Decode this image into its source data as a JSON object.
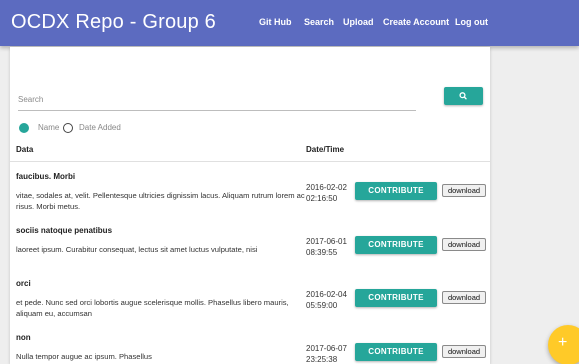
{
  "app": {
    "title": "OCDX Repo - Group 6"
  },
  "nav": {
    "items": [
      {
        "label": "Git Hub"
      },
      {
        "label": "Search"
      },
      {
        "label": "Upload"
      },
      {
        "label": "Create Account"
      },
      {
        "label": "Log out"
      }
    ]
  },
  "search": {
    "placeholder": "Search",
    "value": "",
    "button_icon": "search-icon"
  },
  "sort": {
    "options": [
      {
        "label": "Name",
        "selected": true
      },
      {
        "label": "Date Added",
        "selected": false
      }
    ]
  },
  "table": {
    "headers": {
      "data": "Data",
      "datetime": "Date/Time"
    },
    "rows": [
      {
        "title": "faucibus. Morbi",
        "description": "vitae, sodales at, velit. Pellentesque ultricies dignissim lacus. Aliquam rutrum lorem ac risus. Morbi metus.",
        "date": "2016-02-02",
        "time": "02:16:50",
        "contribute": "CONTRIBUTE",
        "download": "download"
      },
      {
        "title": "sociis natoque penatibus",
        "description": "laoreet ipsum. Curabitur consequat, lectus sit amet luctus vulputate, nisi",
        "date": "2017-06-01",
        "time": "08:39:55",
        "contribute": "CONTRIBUTE",
        "download": "download"
      },
      {
        "title": "orci",
        "description": "et pede. Nunc sed orci lobortis augue scelerisque mollis. Phasellus libero mauris, aliquam eu, accumsan",
        "date": "2016-02-04",
        "time": "05:59:00",
        "contribute": "CONTRIBUTE",
        "download": "download"
      },
      {
        "title": "non",
        "description": "Nulla tempor augue ac ipsum. Phasellus",
        "date": "2017-06-07",
        "time": "23:25:38",
        "contribute": "CONTRIBUTE",
        "download": "download"
      }
    ]
  },
  "fab": {
    "icon": "plus-icon",
    "symbol": "+"
  },
  "colors": {
    "navbar": "#5c6bc0",
    "accent": "#26a69a",
    "fab": "#ffca28"
  }
}
